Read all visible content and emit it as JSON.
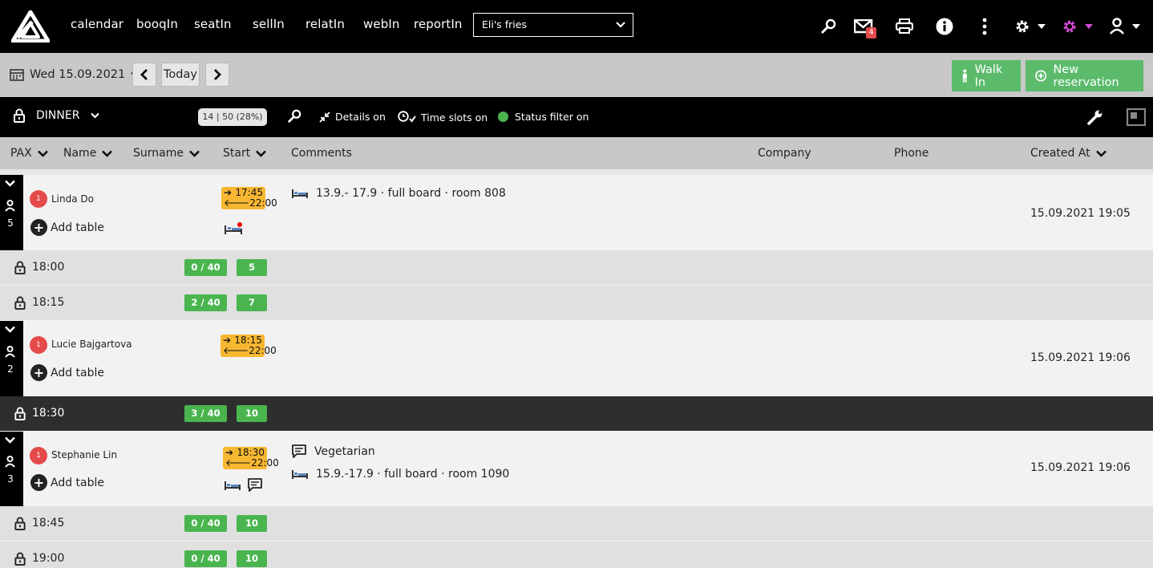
{
  "nav": {
    "links": [
      "calendar",
      "booqIn",
      "seatIn",
      "sellIn",
      "relatIn",
      "webIn",
      "reportIn"
    ],
    "venue": "Eli's fries",
    "mail_badge": "4"
  },
  "datebar": {
    "date": "Wed 15.09.2021",
    "today": "Today",
    "walk_in": "Walk In",
    "new_reservation": "New reservation"
  },
  "service": {
    "name": "DINNER",
    "count": "14 | 50 (28%)",
    "details": "Details on",
    "time_slots": "Time slots on",
    "status_filter": "Status filter on"
  },
  "columns": {
    "pax": "PAX",
    "name": "Name",
    "surname": "Surname",
    "start": "Start",
    "comments": "Comments",
    "company": "Company",
    "phone": "Phone",
    "created_at": "Created At"
  },
  "reservations": [
    {
      "pax": "5",
      "badge": "1",
      "name": "Linda Do",
      "add_table": "Add table",
      "arrive": "17:45",
      "leave": "22:00",
      "comment": "",
      "hotel": "13.9.- 17.9 · full board · room 808",
      "created": "15.09.2021 19:05"
    },
    {
      "pax": "2",
      "badge": "1",
      "name": "Lucie Bajgartova",
      "add_table": "Add table",
      "arrive": "18:15",
      "leave": "22:00",
      "comment": "",
      "hotel": "",
      "created": "15.09.2021 19:06"
    },
    {
      "pax": "3",
      "badge": "1",
      "name": "Stephanie Lin",
      "add_table": "Add table",
      "arrive": "18:30",
      "leave": "22:00",
      "comment": "Vegetarian",
      "hotel": "15.9.-17.9 · full board · room 1090",
      "created": "15.09.2021 19:06"
    }
  ],
  "slots": [
    {
      "time": "18:00",
      "capacity": "0 / 40",
      "count": "5"
    },
    {
      "time": "18:15",
      "capacity": "2 / 40",
      "count": "7"
    },
    {
      "time": "18:30",
      "capacity": "3 / 40",
      "count": "10"
    },
    {
      "time": "18:45",
      "capacity": "0 / 40",
      "count": "10"
    },
    {
      "time": "19:00",
      "capacity": "0 / 40",
      "count": "10"
    }
  ],
  "colors": {
    "accent_green": "#5bbb6b",
    "time_badge": "#f7b731",
    "guest_badge": "#e54a4a",
    "settings_pink": "#d24ad2"
  }
}
